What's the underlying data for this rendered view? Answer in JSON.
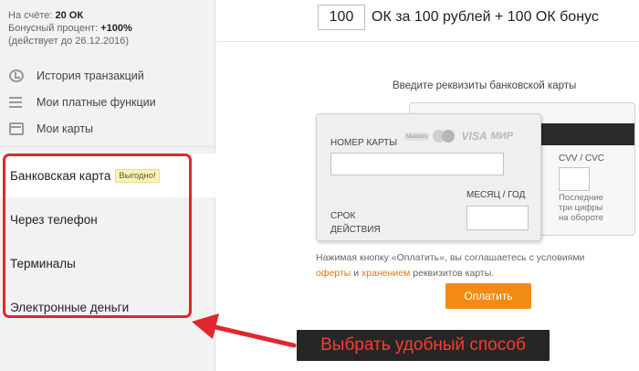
{
  "balance": {
    "label": "На счёте:",
    "value": "20 ОК",
    "bonus_label": "Бонусный процент:",
    "bonus_value": "+100%",
    "valid_until": "(действует до 26.12.2016)"
  },
  "menu": {
    "items": [
      {
        "label": "История транзакций",
        "icon": "history-icon"
      },
      {
        "label": "Мои платные функции",
        "icon": "list-icon"
      },
      {
        "label": "Мои карты",
        "icon": "card-icon"
      }
    ]
  },
  "payment_methods": {
    "items": [
      {
        "label": "Банковская карта",
        "badge": "Выгодно!",
        "active": true
      },
      {
        "label": "Через телефон"
      },
      {
        "label": "Терминалы"
      },
      {
        "label": "Электронные деньги"
      }
    ]
  },
  "purchase": {
    "amount": "100",
    "description": "ОК за 100 рублей + 100 ОК бонус"
  },
  "card_form": {
    "title": "Введите реквизиты банковской карты",
    "logos": {
      "maestro": "Maestro",
      "visa": "VISA",
      "mir": "МИР"
    },
    "number_label": "НОМЕР КАРТЫ",
    "expiry_label_1": "СРОК",
    "expiry_label_2": "ДЕЙСТВИЯ",
    "month_year_label": "МЕСЯЦ / ГОД",
    "cvv_label": "CVV / CVC",
    "cvv_hint_1": "Последние",
    "cvv_hint_2": "три цифры",
    "cvv_hint_3": "на обороте"
  },
  "terms": {
    "prefix": "Нажимая кнопку «Оплатить», вы соглашаетесь с условиями",
    "offer_link": "оферты",
    "and": "и",
    "storage_link": "хранением",
    "suffix": "реквизитов карты."
  },
  "pay_button": {
    "label": "Оплатить"
  },
  "annotation": {
    "text": "Выбрать удобный способ"
  },
  "colors": {
    "accent": "#f28b14",
    "highlight": "#e0272d",
    "callout_bg": "#262626",
    "callout_text": "#ff3a2f"
  }
}
